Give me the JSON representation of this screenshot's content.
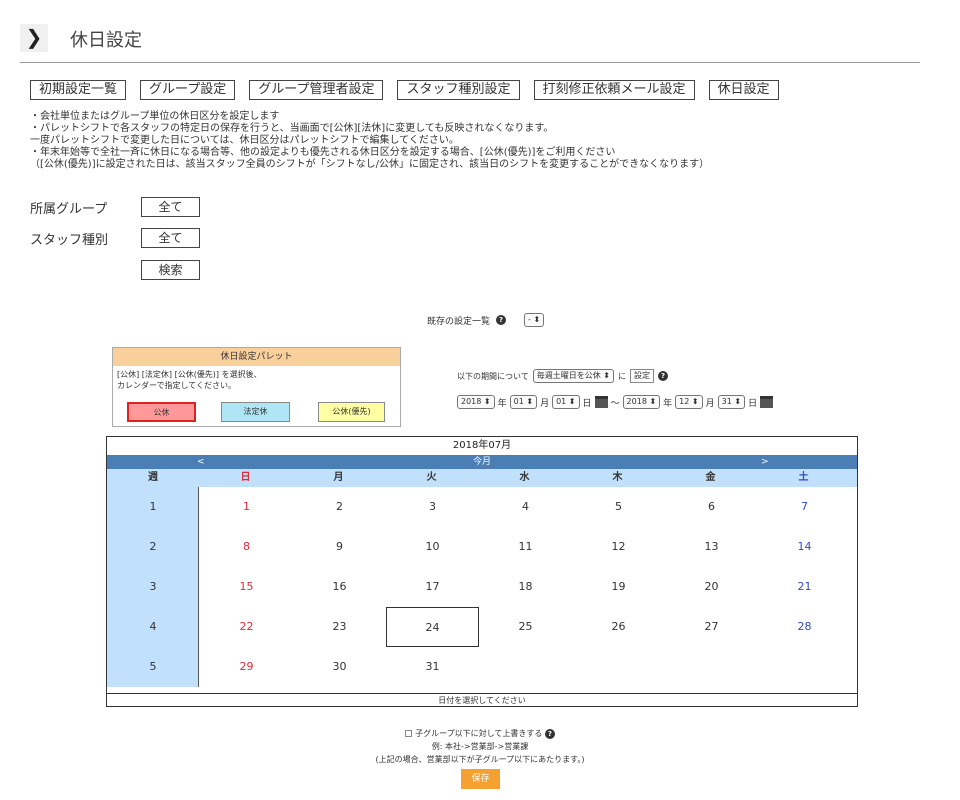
{
  "header": {
    "arrow": "❯",
    "title": "休日設定"
  },
  "tabs": [
    "初期設定一覧",
    "グループ設定",
    "グループ管理者設定",
    "スタッフ種別設定",
    "打刻修正依頼メール設定",
    "休日設定"
  ],
  "notes": [
    "・会社単位またはグループ単位の休日区分を設定します",
    "・パレットシフトで各スタッフの特定日の保存を行うと、当画面で[公休][法休]に変更しても反映されなくなります。",
    "一度パレットシフトで変更した日については、休日区分はパレットシフトで編集してください。",
    "・年末年始等で全社一斉に休日になる場合等、他の設定よりも優先される休日区分を設定する場合、[公休(優先)]をご利用ください",
    "（[公休(優先)]に設定された日は、該当スタッフ全員のシフトが「シフトなし/公休」に固定され、該当日のシフトを変更することができなくなります）"
  ],
  "filters": {
    "group_label": "所属グループ",
    "group_value": "全て",
    "staff_label": "スタッフ種別",
    "staff_value": "全て",
    "search_label": "検索"
  },
  "existing": {
    "label": "既存の設定一覧",
    "value": "-"
  },
  "palette": {
    "title": "休日設定パレット",
    "line1": "[公休] [法定休] [公休(優先)] を選択後、",
    "line2": "カレンダーで指定してください。",
    "kokyu": "公休",
    "hotei": "法定休",
    "yusen": "公休(優先)"
  },
  "period": {
    "prefix": "以下の期間について",
    "rule": "毎週土曜日を公休",
    "ni": "に",
    "set_label": "設定",
    "from_year": "2018",
    "from_month": "01",
    "from_day": "01",
    "to_year": "2018",
    "to_month": "12",
    "to_day": "31",
    "year_unit": "年",
    "month_unit": "月",
    "day_unit": "日",
    "tilde": "～"
  },
  "calendar": {
    "title": "2018年07月",
    "prev": "<",
    "today": "今月",
    "next": ">",
    "headers": [
      "週",
      "日",
      "月",
      "火",
      "水",
      "木",
      "金",
      "土"
    ],
    "weeks": [
      {
        "week": "1",
        "days": [
          "1",
          "2",
          "3",
          "4",
          "5",
          "6",
          "7"
        ]
      },
      {
        "week": "2",
        "days": [
          "8",
          "9",
          "10",
          "11",
          "12",
          "13",
          "14"
        ]
      },
      {
        "week": "3",
        "days": [
          "15",
          "16",
          "17",
          "18",
          "19",
          "20",
          "21"
        ]
      },
      {
        "week": "4",
        "days": [
          "22",
          "23",
          "24",
          "25",
          "26",
          "27",
          "28"
        ]
      },
      {
        "week": "5",
        "days": [
          "29",
          "30",
          "31",
          "",
          "",
          "",
          ""
        ]
      }
    ],
    "selected_day": "24",
    "footer": "日付を選択してください"
  },
  "bottom": {
    "override_label": "子グループ以下に対して上書きする",
    "example": "例: 本社->営業部->営業課",
    "note": "(上記の場合、営業部以下が子グループ以下にあたります。)",
    "save": "保存"
  }
}
